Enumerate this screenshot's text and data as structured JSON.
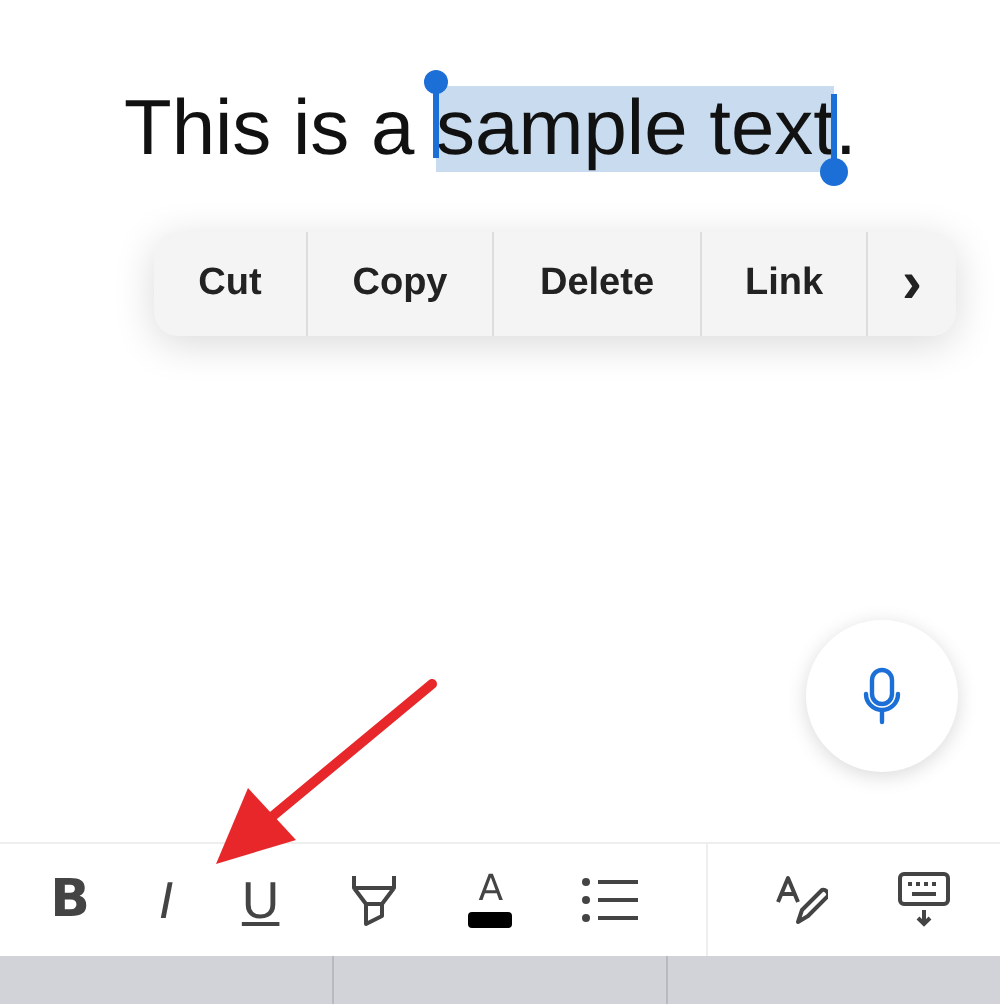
{
  "document": {
    "text_before": "This is a ",
    "selection": "sample text",
    "text_after": "."
  },
  "edit_menu": {
    "items": [
      "Cut",
      "Copy",
      "Delete",
      "Link"
    ],
    "more": "›"
  },
  "toolbar": {
    "items": [
      {
        "kind": "bold",
        "label": "B"
      },
      {
        "kind": "italic",
        "label": "I"
      },
      {
        "kind": "underline",
        "label": "U"
      },
      {
        "kind": "highlight"
      },
      {
        "kind": "color",
        "label": "A"
      },
      {
        "kind": "list"
      },
      {
        "kind": "divider"
      },
      {
        "kind": "spell"
      },
      {
        "kind": "keyboard"
      }
    ]
  }
}
